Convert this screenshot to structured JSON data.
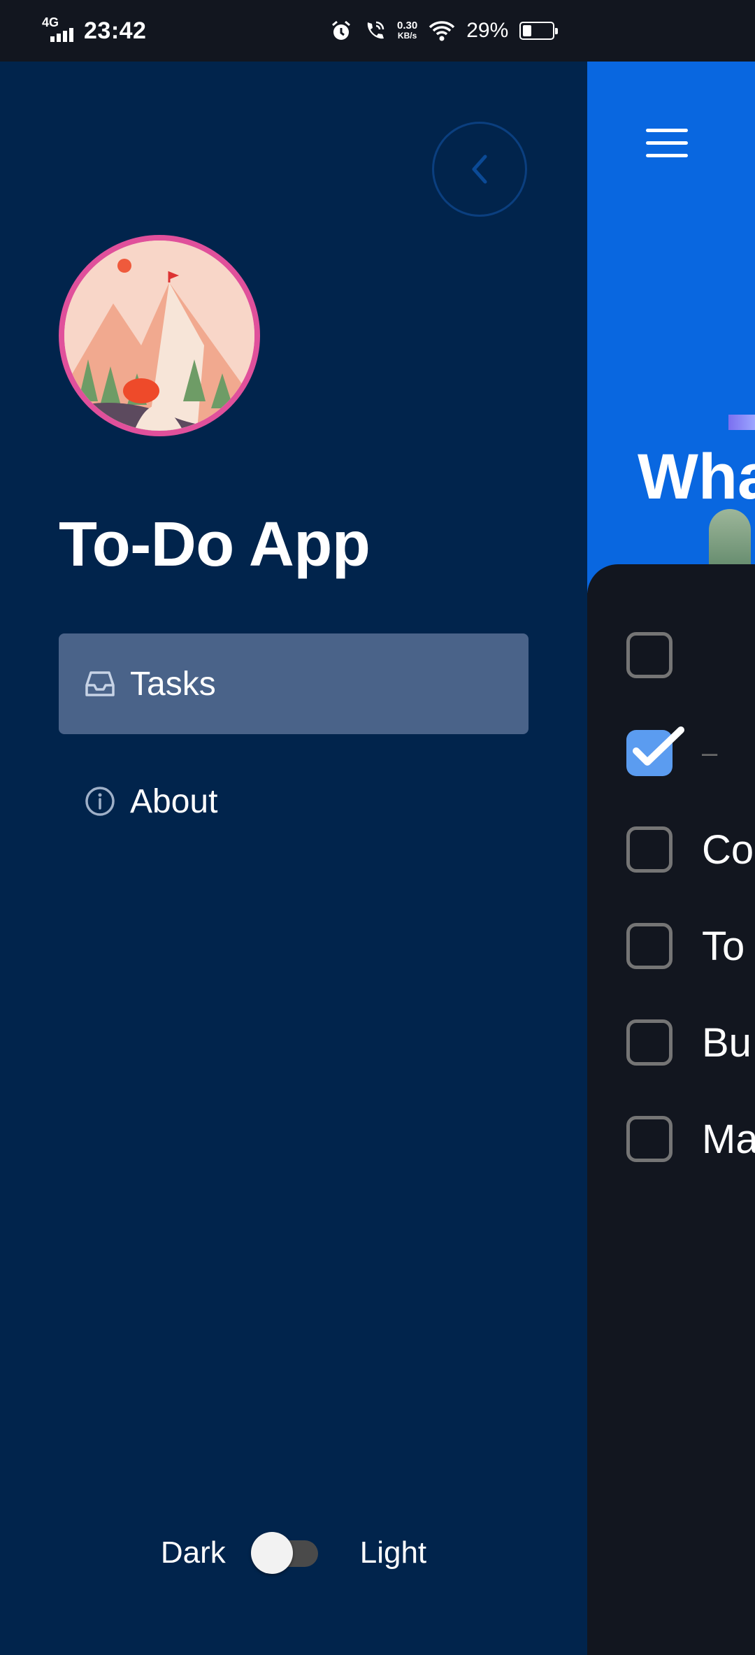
{
  "status_bar": {
    "network": "4G",
    "time": "23:42",
    "speed_value": "0.30",
    "speed_unit": "KB/s",
    "battery_pct": "29%",
    "battery_level": 0.29
  },
  "drawer": {
    "app_title": "To-Do App",
    "nav": [
      {
        "label": "Tasks",
        "icon": "inbox-icon",
        "active": true
      },
      {
        "label": "About",
        "icon": "info-icon",
        "active": false
      }
    ],
    "theme": {
      "dark_label": "Dark",
      "light_label": "Light",
      "is_light": false
    }
  },
  "main": {
    "header_title": "Wha",
    "tasks": [
      {
        "text": "",
        "checked": false
      },
      {
        "text": "–",
        "checked": true
      },
      {
        "text": "Co",
        "checked": false
      },
      {
        "text": "To",
        "checked": false
      },
      {
        "text": "Bu",
        "checked": false
      },
      {
        "text": "Ma",
        "checked": false
      }
    ]
  },
  "colors": {
    "drawer_bg": "#01244c",
    "header_blue": "#0967e0",
    "active_nav": "#4a6389",
    "avatar_ring": "#e0509b",
    "checked_box": "#5b9cf0"
  }
}
